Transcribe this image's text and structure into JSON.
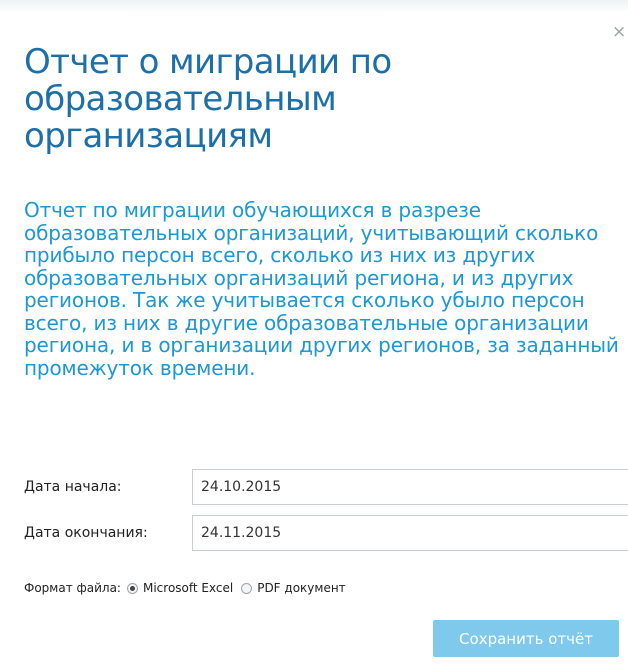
{
  "dialog": {
    "close_glyph": "×",
    "title": "Отчет о миграции по образовательным организациям",
    "description": "Отчет по миграции обучающихся в разрезе образовательных организаций, учитывающий сколько прибыло персон всего, сколько из них из других образовательных организаций региона, и из других регионов. Так же учитывается сколько убыло персон всего, из них в другие образовательные организации региона, и в организации других регионов, за заданный промежуток времени."
  },
  "form": {
    "start_date": {
      "label": "Дата начала:",
      "value": "24.10.2015"
    },
    "end_date": {
      "label": "Дата окончания:",
      "value": "24.11.2015"
    },
    "file_format": {
      "label": "Формат файла:",
      "options": [
        {
          "label": "Microsoft Excel",
          "selected": true
        },
        {
          "label": "PDF документ",
          "selected": false
        }
      ]
    }
  },
  "actions": {
    "save_label": "Сохранить отчёт"
  },
  "colors": {
    "title": "#1d6fa8",
    "description": "#1c98d4",
    "button_bg": "#7ec9ec",
    "button_text": "#ffffff"
  }
}
